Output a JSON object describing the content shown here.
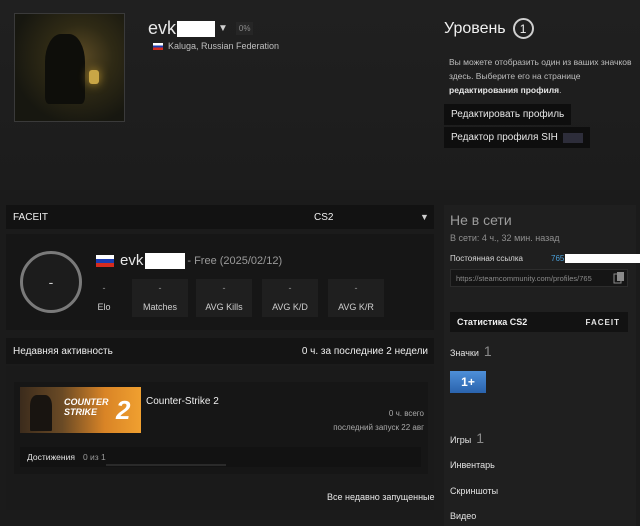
{
  "profile": {
    "name": "evk",
    "percent": "0%",
    "location": "Kaluga, Russian Federation"
  },
  "level": {
    "title": "Уровень",
    "value": "1",
    "desc_text": "Вы можете отобразить один из ваших значков здесь. Выберите его на странице",
    "desc_link": "редактирования профиля",
    "edit_button": "Редактировать профиль",
    "sih_button": "Редактор профиля SIH"
  },
  "faceit": {
    "label": "FACEIT",
    "game": "CS2",
    "ring_value": "-",
    "player_name": "evk",
    "player_sub": "- Free (2025/02/12)",
    "stats": [
      {
        "value": "-",
        "label": "Elo"
      },
      {
        "value": "-",
        "label": "Matches"
      },
      {
        "value": "-",
        "label": "AVG Kills"
      },
      {
        "value": "-",
        "label": "AVG K/D"
      },
      {
        "value": "-",
        "label": "AVG K/R"
      }
    ]
  },
  "recent": {
    "title": "Недавняя активность",
    "hours": "0 ч. за последние 2 недели",
    "game": {
      "title": "Counter-Strike 2",
      "logo_text": "COUNTER STRIKE",
      "logo_num": "2",
      "hours_total": "0 ч. всего",
      "last_played": "последний запуск 22 авг",
      "achievements_label": "Достижения",
      "achievements_count": "0 из 1",
      "achievements_progress": 0
    },
    "all_link": "Все недавно запущенные"
  },
  "sidebar": {
    "status": "Не в сети",
    "last_seen": "В сети: 4 ч., 32 мин. назад",
    "permalink_label": "Постоянная ссылка",
    "permalink_id": "765",
    "permalink_url": "https://steamcommunity.com/profiles/765",
    "cs2_stats_label": "Статистика CS2",
    "cs2_stats_brand": "FACEIT",
    "badges_label": "Значки",
    "badges_count": "1",
    "badge_text": "1+",
    "games_label": "Игры",
    "games_count": "1",
    "inventory": "Инвентарь",
    "screenshots": "Скриншоты",
    "video": "Видео"
  },
  "colors": {
    "background": "#1b1b1b",
    "link": "#4a9fd8",
    "badge": "#3a78c4"
  }
}
